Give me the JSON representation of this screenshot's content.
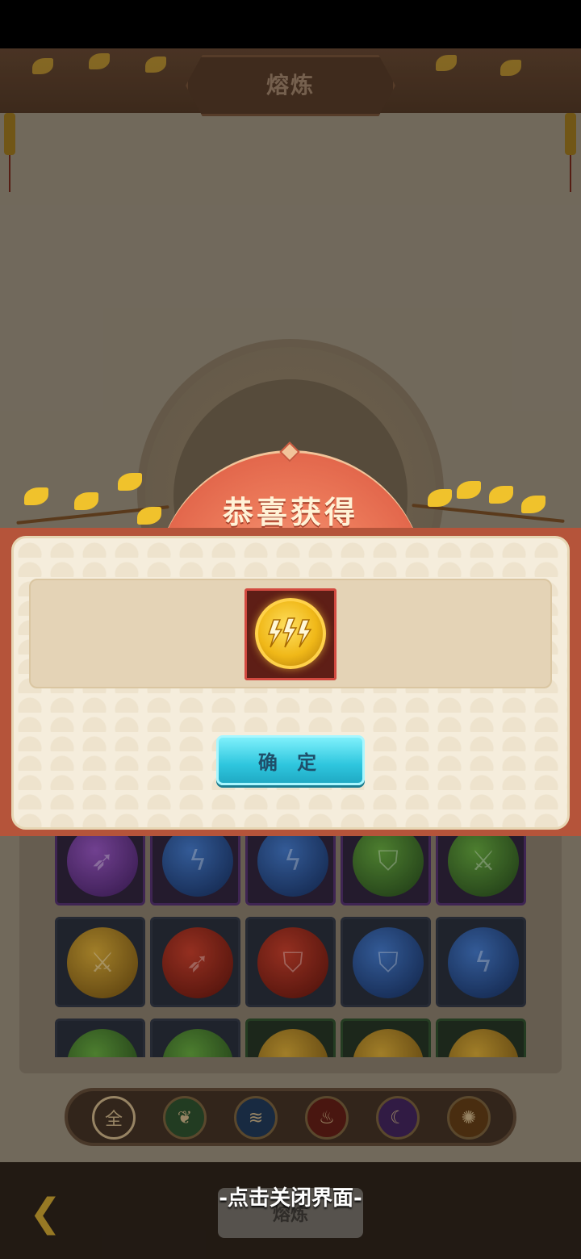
{
  "page": {
    "title": "熔炼",
    "bottom_button_label": "熔炼"
  },
  "dialog": {
    "title": "恭喜获得",
    "reward_item_icon": "lightning-coin-icon",
    "confirm_label": "确 定"
  },
  "overlay": {
    "close_hint": "-点击关闭界面-"
  },
  "filters": [
    {
      "label": "全",
      "icon": "all-icon"
    },
    {
      "label": "",
      "icon": "leaf-element-icon"
    },
    {
      "label": "",
      "icon": "water-element-icon"
    },
    {
      "label": "",
      "icon": "fire-element-icon"
    },
    {
      "label": "",
      "icon": "moon-element-icon"
    },
    {
      "label": "",
      "icon": "sun-element-icon"
    }
  ],
  "colors": {
    "dialog_accent": "#d8523c",
    "confirm_button": "#2ec6de",
    "item_frame": "#d24a40"
  }
}
